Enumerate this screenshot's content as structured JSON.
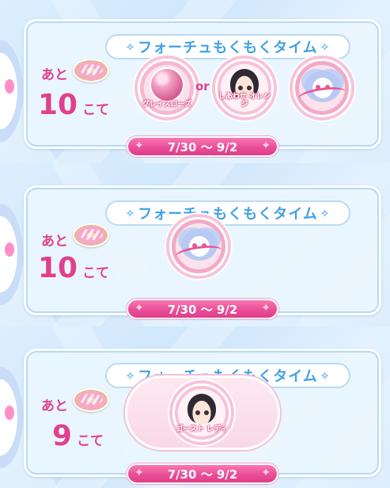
{
  "panels": [
    {
      "title": "フォーチュもくもくタイム",
      "remain_prefix": "あと",
      "count": "10",
      "unit": "こて",
      "rewards": [
        {
          "label": "グレイスローズ",
          "icon": "gem-icon"
        },
        {
          "label": "しあわせ オレンジ",
          "icon": "character-icon"
        },
        {
          "label": "",
          "icon": "plush-icon"
        }
      ],
      "or_text": "or",
      "date_range": "7/30 ～ 9/2"
    },
    {
      "title": "フォーチュもくもくタイム",
      "remain_prefix": "あと",
      "count": "10",
      "unit": "こて",
      "rewards": [
        {
          "label": "",
          "icon": "plush-icon"
        }
      ],
      "date_range": "7/30 ～ 9/2"
    },
    {
      "title": "フォーチュもくもくタイム",
      "remain_prefix": "あと",
      "count": "9",
      "unit": "こて",
      "rewards": [
        {
          "label": "ゴースト レディ",
          "icon": "character-icon"
        }
      ],
      "date_range": "7/30 ～ 9/2"
    }
  ],
  "colors": {
    "accent_pink": "#e0408e",
    "title_blue": "#3fa0e8",
    "bar_pink": "#ea4f97"
  }
}
